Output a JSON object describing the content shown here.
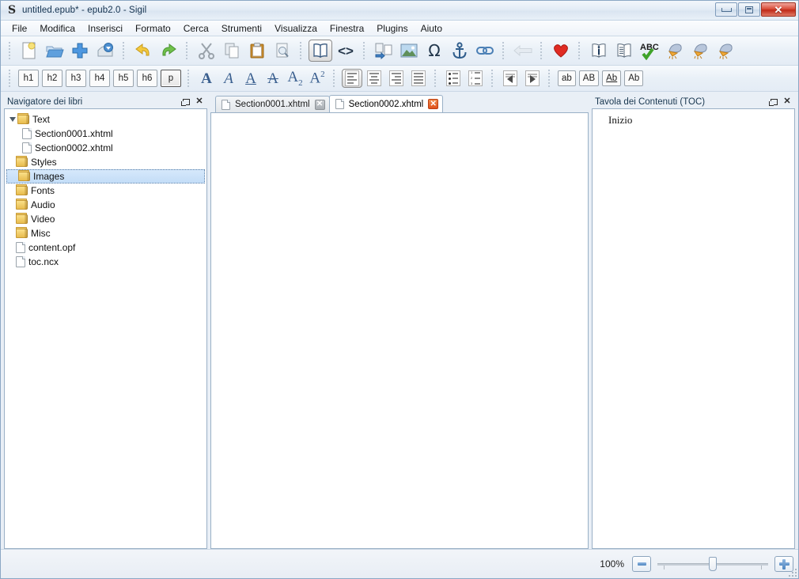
{
  "window": {
    "title": "untitled.epub* - epub2.0 - Sigil",
    "app_icon": "sigil-s-icon",
    "controls": {
      "minimize": "minimize-button",
      "maximize": "maximize-button",
      "close": "close-button",
      "close_glyph": "✕"
    }
  },
  "menubar": {
    "items": [
      {
        "label": "File"
      },
      {
        "label": "Modifica"
      },
      {
        "label": "Inserisci"
      },
      {
        "label": "Formato"
      },
      {
        "label": "Cerca"
      },
      {
        "label": "Strumenti"
      },
      {
        "label": "Visualizza"
      },
      {
        "label": "Finestra"
      },
      {
        "label": "Plugins"
      },
      {
        "label": "Aiuto"
      }
    ]
  },
  "toolbar_main": {
    "groups": [
      {
        "buttons": [
          {
            "name": "new-file",
            "icon": "new-document-icon"
          },
          {
            "name": "open-file",
            "icon": "open-folder-icon"
          },
          {
            "name": "add-file",
            "icon": "add-plus-icon"
          },
          {
            "name": "save-file",
            "icon": "save-disk-icon"
          }
        ]
      },
      {
        "buttons": [
          {
            "name": "undo",
            "icon": "undo-arrow-icon"
          },
          {
            "name": "redo",
            "icon": "redo-arrow-icon"
          }
        ]
      },
      {
        "buttons": [
          {
            "name": "cut",
            "icon": "scissors-icon"
          },
          {
            "name": "copy",
            "icon": "copy-pages-icon"
          },
          {
            "name": "paste",
            "icon": "clipboard-icon"
          },
          {
            "name": "print-preview",
            "icon": "print-preview-icon"
          }
        ]
      },
      {
        "buttons": [
          {
            "name": "book-view",
            "icon": "open-book-icon",
            "state": "active"
          },
          {
            "name": "code-view",
            "icon": "code-brackets-icon",
            "label": "<>"
          }
        ]
      },
      {
        "buttons": [
          {
            "name": "split-at-cursor",
            "icon": "split-section-icon"
          },
          {
            "name": "insert-image",
            "icon": "picture-icon"
          },
          {
            "name": "insert-special-character",
            "icon": "omega-icon",
            "label": "Ω"
          },
          {
            "name": "insert-id",
            "icon": "anchor-icon"
          },
          {
            "name": "insert-link",
            "icon": "chain-link-icon"
          }
        ]
      },
      {
        "buttons": [
          {
            "name": "back",
            "icon": "back-arrow-icon",
            "state": "disabled"
          }
        ]
      },
      {
        "buttons": [
          {
            "name": "add-to-index",
            "icon": "heart-icon"
          }
        ]
      },
      {
        "buttons": [
          {
            "name": "metadata-editor",
            "icon": "info-book-icon"
          },
          {
            "name": "generate-toc",
            "icon": "index-book-icon"
          },
          {
            "name": "spellcheck",
            "icon": "abc-spellcheck-icon",
            "label": "ABC"
          },
          {
            "name": "clean-source",
            "icon": "broom-clean-icon"
          },
          {
            "name": "mend-source",
            "icon": "broom-mend-icon"
          },
          {
            "name": "mend-all-source",
            "icon": "broom-mend-all-icon"
          }
        ]
      }
    ]
  },
  "toolbar_format": {
    "headings": [
      {
        "label": "h1",
        "state": ""
      },
      {
        "label": "h2",
        "state": ""
      },
      {
        "label": "h3",
        "state": ""
      },
      {
        "label": "h4",
        "state": ""
      },
      {
        "label": "h5",
        "state": ""
      },
      {
        "label": "h6",
        "state": ""
      },
      {
        "label": "p",
        "state": "active"
      }
    ],
    "styles": [
      {
        "name": "bold",
        "glyph": "A",
        "style": "bold"
      },
      {
        "name": "italic",
        "glyph": "A",
        "style": "ital"
      },
      {
        "name": "underline",
        "glyph": "A",
        "style": "und"
      },
      {
        "name": "strikethrough",
        "glyph": "A",
        "style": "strike"
      },
      {
        "name": "subscript",
        "glyph": "A",
        "sub": "2"
      },
      {
        "name": "superscript",
        "glyph": "A",
        "sup": "2"
      }
    ],
    "align": [
      {
        "name": "align-left",
        "state": "active"
      },
      {
        "name": "align-center",
        "state": ""
      },
      {
        "name": "align-right",
        "state": ""
      },
      {
        "name": "align-justify",
        "state": ""
      }
    ],
    "lists": [
      {
        "name": "bullet-list"
      },
      {
        "name": "numbered-list"
      }
    ],
    "indent": [
      {
        "name": "decrease-indent"
      },
      {
        "name": "increase-indent"
      }
    ],
    "case": [
      {
        "label": "ab",
        "name": "lowercase"
      },
      {
        "label": "AB",
        "name": "uppercase"
      },
      {
        "label": "Ab",
        "name": "titlecase"
      },
      {
        "label": "Ab",
        "name": "capitalize"
      }
    ]
  },
  "book_browser": {
    "title": "Navigatore dei libri",
    "items": [
      {
        "label": "Text",
        "type": "folder",
        "expanded": true,
        "indent": 0
      },
      {
        "label": "Section0001.xhtml",
        "type": "file",
        "indent": 1
      },
      {
        "label": "Section0002.xhtml",
        "type": "file",
        "indent": 1
      },
      {
        "label": "Styles",
        "type": "folder",
        "indent": 0
      },
      {
        "label": "Images",
        "type": "folder",
        "indent": 0,
        "selected": true
      },
      {
        "label": "Fonts",
        "type": "folder",
        "indent": 0
      },
      {
        "label": "Audio",
        "type": "folder",
        "indent": 0
      },
      {
        "label": "Video",
        "type": "folder",
        "indent": 0
      },
      {
        "label": "Misc",
        "type": "folder",
        "indent": 0
      },
      {
        "label": "content.opf",
        "type": "file",
        "indent": 0
      },
      {
        "label": "toc.ncx",
        "type": "file",
        "indent": 0
      }
    ]
  },
  "editor": {
    "tabs": [
      {
        "label": "Section0001.xhtml",
        "active": false,
        "close_glyph": "✕"
      },
      {
        "label": "Section0002.xhtml",
        "active": true,
        "close_glyph": "✕"
      }
    ],
    "content": ""
  },
  "toc_panel": {
    "title": "Tavola dei Contenuti (TOC)",
    "items": [
      {
        "label": "Inizio"
      }
    ]
  },
  "statusbar": {
    "zoom_label": "100%",
    "zoom_out": "zoom-out-button",
    "zoom_in": "zoom-in-button",
    "slider_value": 50
  },
  "colors": {
    "accent_blue": "#4f86c0",
    "selection": "#c3ddf7",
    "close_red": "#d9503c",
    "tab_close_active": "#e0521c",
    "folder_yellow": "#e8bc4e"
  }
}
